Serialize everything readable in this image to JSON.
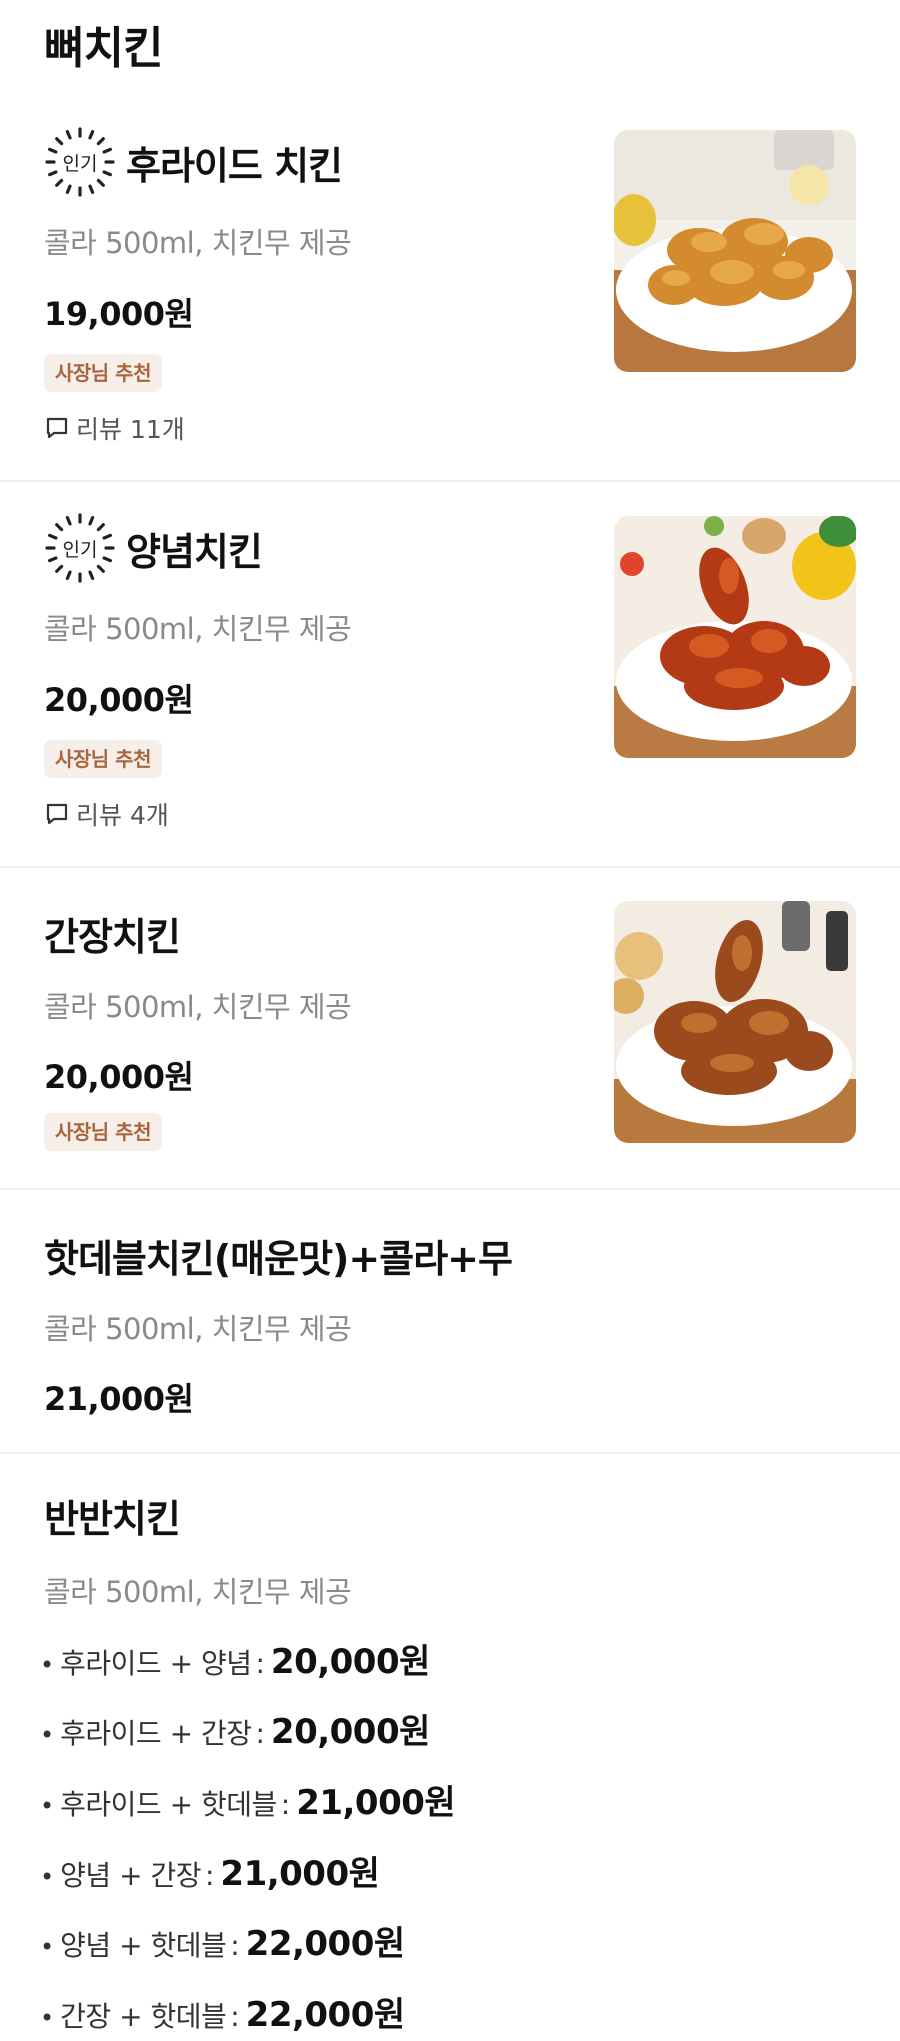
{
  "section": {
    "title": "뼈치킨"
  },
  "popular_badge_text": "인기",
  "items": [
    {
      "name": "후라이드 치킨",
      "desc": "콜라 500ml, 치킨무 제공",
      "price": "19,000원",
      "badge": "사장님 추천",
      "review": "리뷰 11개",
      "image": "fried-chicken-photo"
    },
    {
      "name": "양념치킨",
      "desc": "콜라 500ml, 치킨무 제공",
      "price": "20,000원",
      "badge": "사장님 추천",
      "review": "리뷰 4개",
      "image": "seasoned-chicken-photo"
    },
    {
      "name": "간장치킨",
      "desc": "콜라 500ml, 치킨무 제공",
      "price": "20,000원",
      "badge": "사장님 추천",
      "image": "soy-chicken-photo"
    },
    {
      "name": "핫데블치킨(매운맛)+콜라+무",
      "desc": "콜라 500ml, 치킨무 제공",
      "price": "21,000원"
    },
    {
      "name": "반반치킨",
      "desc": "콜라 500ml, 치킨무 제공",
      "half_options": [
        {
          "combo": "후라이드 + 양념",
          "price": "20,000원"
        },
        {
          "combo": "후라이드 + 간장",
          "price": "20,000원"
        },
        {
          "combo": "후라이드 + 핫데블",
          "price": "21,000원"
        },
        {
          "combo": "양념 + 간장",
          "price": "21,000원"
        },
        {
          "combo": "양념 + 핫데블",
          "price": "22,000원"
        },
        {
          "combo": "간장 + 핫데블",
          "price": "22,000원"
        }
      ]
    }
  ],
  "colors": {
    "badge_bg": "#f6eee8",
    "badge_text": "#a8663f",
    "desc_text": "#8a8a8a",
    "divider": "#f0f0f0"
  }
}
